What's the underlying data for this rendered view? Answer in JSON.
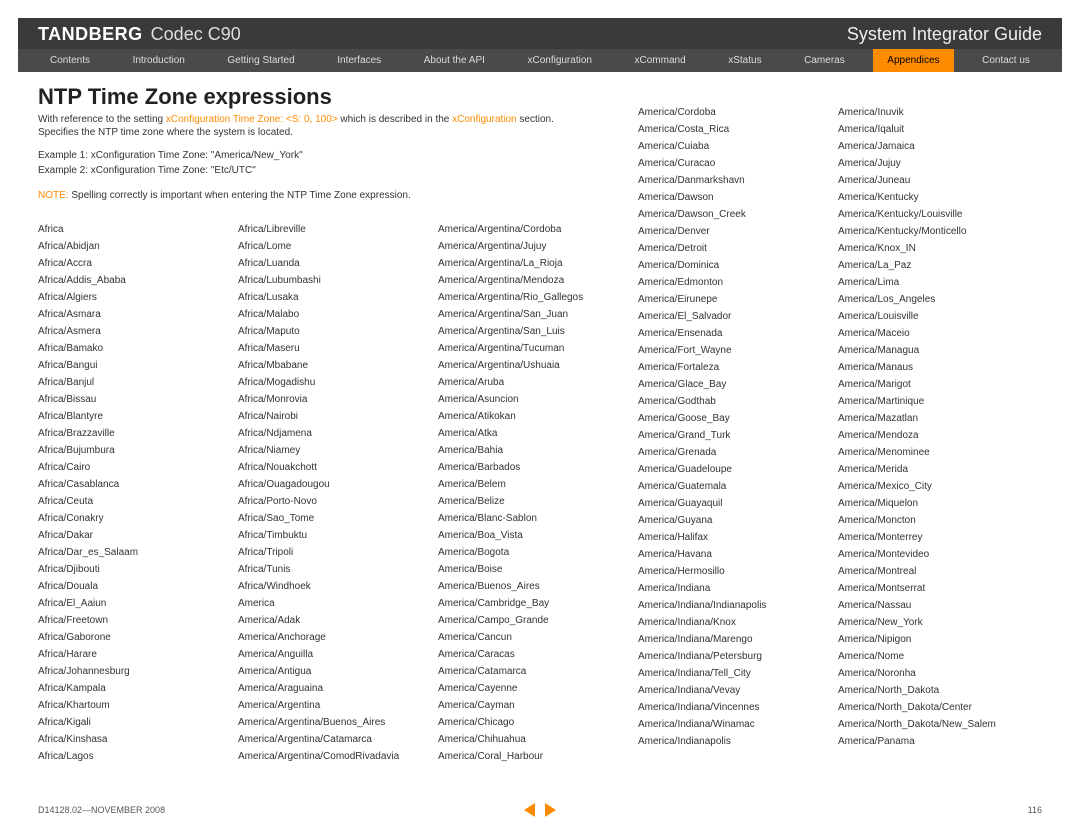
{
  "header": {
    "brand": "TANDBERG",
    "model": "Codec C90",
    "guide": "System Integrator Guide"
  },
  "nav": {
    "items": [
      {
        "label": "Contents"
      },
      {
        "label": "Introduction"
      },
      {
        "label": "Getting Started"
      },
      {
        "label": "Interfaces"
      },
      {
        "label": "About the API"
      },
      {
        "label": "xConfiguration"
      },
      {
        "label": "xCommand"
      },
      {
        "label": "xStatus"
      },
      {
        "label": "Cameras"
      },
      {
        "label": "Appendices",
        "active": true
      },
      {
        "label": "Contact us"
      }
    ]
  },
  "title": "NTP Time Zone expressions",
  "intro": {
    "pre": "With reference to the setting ",
    "link1": "xConfiguration Time Zone: <S: 0, 100>",
    "mid": " which is described in the ",
    "link2": "xConfiguration",
    "post": " section.",
    "line2": "Specifies the NTP time zone where the system is located.",
    "example1": "Example 1: xConfiguration Time Zone: \"America/New_York\"",
    "example2": "Example 2: xConfiguration Time Zone: \"Etc/UTC\"",
    "note_label": "NOTE:",
    "note_text": " Spelling correctly is important when entering the NTP Time Zone expression."
  },
  "timezones": {
    "col1": [
      "Africa",
      "Africa/Abidjan",
      "Africa/Accra",
      "Africa/Addis_Ababa",
      "Africa/Algiers",
      "Africa/Asmara",
      "Africa/Asmera",
      "Africa/Bamako",
      "Africa/Bangui",
      "Africa/Banjul",
      "Africa/Bissau",
      "Africa/Blantyre",
      "Africa/Brazzaville",
      "Africa/Bujumbura",
      "Africa/Cairo",
      "Africa/Casablanca",
      "Africa/Ceuta",
      "Africa/Conakry",
      "Africa/Dakar",
      "Africa/Dar_es_Salaam",
      "Africa/Djibouti",
      "Africa/Douala",
      "Africa/El_Aaiun",
      "Africa/Freetown",
      "Africa/Gaborone",
      "Africa/Harare",
      "Africa/Johannesburg",
      "Africa/Kampala",
      "Africa/Khartoum",
      "Africa/Kigali",
      "Africa/Kinshasa",
      "Africa/Lagos"
    ],
    "col2": [
      "Africa/Libreville",
      "Africa/Lome",
      "Africa/Luanda",
      "Africa/Lubumbashi",
      "Africa/Lusaka",
      "Africa/Malabo",
      "Africa/Maputo",
      "Africa/Maseru",
      "Africa/Mbabane",
      "Africa/Mogadishu",
      "Africa/Monrovia",
      "Africa/Nairobi",
      "Africa/Ndjamena",
      "Africa/Niamey",
      "Africa/Nouakchott",
      "Africa/Ouagadougou",
      "Africa/Porto-Novo",
      "Africa/Sao_Tome",
      "Africa/Timbuktu",
      "Africa/Tripoli",
      "Africa/Tunis",
      "Africa/Windhoek",
      "America",
      "America/Adak",
      "America/Anchorage",
      "America/Anguilla",
      "America/Antigua",
      "America/Araguaina",
      "America/Argentina",
      "America/Argentina/Buenos_Aires",
      "America/Argentina/Catamarca",
      "America/Argentina/ComodRivadavia"
    ],
    "col3": [
      "America/Argentina/Cordoba",
      "America/Argentina/Jujuy",
      "America/Argentina/La_Rioja",
      "America/Argentina/Mendoza",
      "America/Argentina/Rio_Gallegos",
      "America/Argentina/San_Juan",
      "America/Argentina/San_Luis",
      "America/Argentina/Tucuman",
      "America/Argentina/Ushuaia",
      "America/Aruba",
      "America/Asuncion",
      "America/Atikokan",
      "America/Atka",
      "America/Bahia",
      "America/Barbados",
      "America/Belem",
      "America/Belize",
      "America/Blanc-Sablon",
      "America/Boa_Vista",
      "America/Bogota",
      "America/Boise",
      "America/Buenos_Aires",
      "America/Cambridge_Bay",
      "America/Campo_Grande",
      "America/Cancun",
      "America/Caracas",
      "America/Catamarca",
      "America/Cayenne",
      "America/Cayman",
      "America/Chicago",
      "America/Chihuahua",
      "America/Coral_Harbour"
    ],
    "col4": [
      "America/Cordoba",
      "America/Costa_Rica",
      "America/Cuiaba",
      "America/Curacao",
      "America/Danmarkshavn",
      "America/Dawson",
      "America/Dawson_Creek",
      "America/Denver",
      "America/Detroit",
      "America/Dominica",
      "America/Edmonton",
      "America/Eirunepe",
      "America/El_Salvador",
      "America/Ensenada",
      "America/Fort_Wayne",
      "America/Fortaleza",
      "America/Glace_Bay",
      "America/Godthab",
      "America/Goose_Bay",
      "America/Grand_Turk",
      "America/Grenada",
      "America/Guadeloupe",
      "America/Guatemala",
      "America/Guayaquil",
      "America/Guyana",
      "America/Halifax",
      "America/Havana",
      "America/Hermosillo",
      "America/Indiana",
      "America/Indiana/Indianapolis",
      "America/Indiana/Knox",
      "America/Indiana/Marengo",
      "America/Indiana/Petersburg",
      "America/Indiana/Tell_City",
      "America/Indiana/Vevay",
      "America/Indiana/Vincennes",
      "America/Indiana/Winamac",
      "America/Indianapolis"
    ],
    "col5": [
      "America/Inuvik",
      "America/Iqaluit",
      "America/Jamaica",
      "America/Jujuy",
      "America/Juneau",
      "America/Kentucky",
      "America/Kentucky/Louisville",
      "America/Kentucky/Monticello",
      "America/Knox_IN",
      "America/La_Paz",
      "America/Lima",
      "America/Los_Angeles",
      "America/Louisville",
      "America/Maceio",
      "America/Managua",
      "America/Manaus",
      "America/Marigot",
      "America/Martinique",
      "America/Mazatlan",
      "America/Mendoza",
      "America/Menominee",
      "America/Merida",
      "America/Mexico_City",
      "America/Miquelon",
      "America/Moncton",
      "America/Monterrey",
      "America/Montevideo",
      "America/Montreal",
      "America/Montserrat",
      "America/Nassau",
      "America/New_York",
      "America/Nipigon",
      "America/Nome",
      "America/Noronha",
      "America/North_Dakota",
      "America/North_Dakota/Center",
      "America/North_Dakota/New_Salem",
      "America/Panama"
    ]
  },
  "footer": {
    "docid": "D14128.02—NOVEMBER 2008",
    "page": "116"
  }
}
